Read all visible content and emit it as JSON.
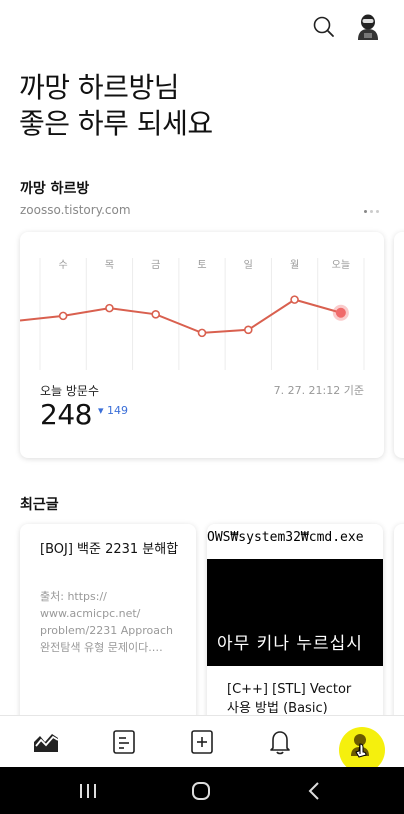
{
  "greeting": {
    "line1": "까망 하르방님",
    "line2": "좋은 하루 되세요"
  },
  "blog": {
    "name": "까망 하르방",
    "url": "zoosso.tistory.com"
  },
  "stats": {
    "visit_label": "오늘 방문수",
    "visit_count": "248",
    "visit_delta": "▾ 149",
    "timestamp": "7. 27. 21:12 기준"
  },
  "chart_data": {
    "type": "line",
    "categories": [
      "수",
      "목",
      "금",
      "토",
      "일",
      "월",
      "오늘"
    ],
    "values": [
      240,
      260,
      244,
      196,
      204,
      282,
      248
    ],
    "highlight_index": 6,
    "ylim": [
      100,
      400
    ],
    "grid": true,
    "colors": {
      "line": "#d9604f",
      "highlight": "#f06a6a",
      "grid": "#ececec"
    }
  },
  "recent": {
    "title": "최근글",
    "posts": [
      {
        "title": "[BOJ] 백준 2231 분해합",
        "excerpt": "출처: https:// www.acmicpc.net/ problem/2231 Approach 완전탐색 유형 문제이다.…"
      },
      {
        "image_path": "OWS₩system32₩cmd.exe",
        "image_text": "아무 키나 누르십시",
        "title": "[C++] [STL] Vector 사용 방법 (Basic)"
      }
    ]
  },
  "icons": {
    "search": "search-icon",
    "avatar": "avatar-icon",
    "nav": [
      "stats-icon",
      "post-list-icon",
      "new-post-icon",
      "notification-icon",
      "profile-icon"
    ],
    "system": [
      "recent-apps-icon",
      "home-icon",
      "back-icon"
    ]
  },
  "colors": {
    "accent": "#d9604f",
    "delta_blue": "#3b6fd8",
    "touch_indicator": "#f5f00d"
  }
}
